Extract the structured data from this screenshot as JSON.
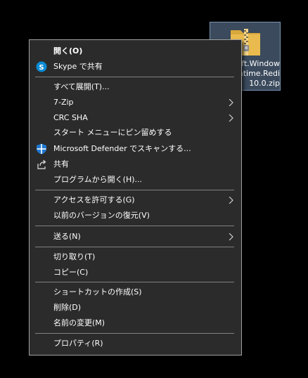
{
  "file": {
    "name_lines": [
      "oft.Window",
      "untime.Redi",
      "10.0.zip"
    ]
  },
  "menu": {
    "open": "開く(O)",
    "skype": "Skype で共有",
    "extract_all": "すべて展開(T)...",
    "seven_zip": "7-Zip",
    "crc_sha": "CRC SHA",
    "pin_start": "スタート メニューにピン留めする",
    "defender": "Microsoft Defender でスキャンする...",
    "share": "共有",
    "open_with": "プログラムから開く(H)...",
    "give_access": "アクセスを許可する(G)",
    "restore_versions": "以前のバージョンの復元(V)",
    "send_to": "送る(N)",
    "cut": "切り取り(T)",
    "copy": "コピー(C)",
    "create_shortcut": "ショートカットの作成(S)",
    "delete": "削除(D)",
    "rename": "名前の変更(M)",
    "properties": "プロパティ(R)"
  },
  "colors": {
    "menu_bg": "#2b2b2b",
    "text": "#ffffff",
    "separator": "#808080",
    "skype_blue": "#0a8bd6",
    "defender_blue": "#1f78d1",
    "selection_bg": "#3b4a5c",
    "selection_border": "#7894b2",
    "zip_yellow": "#e9bb4e"
  },
  "icons": {
    "skype": "skype-icon",
    "defender": "defender-shield-icon",
    "share": "share-icon",
    "submenu": "chevron-right-icon",
    "zip": "zip-folder-icon"
  }
}
